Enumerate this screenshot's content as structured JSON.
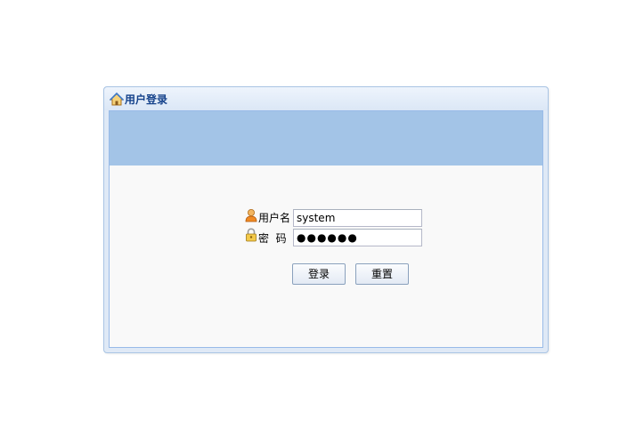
{
  "panel": {
    "title": "用户登录",
    "title_icon": "home-icon"
  },
  "form": {
    "username_label": "用户名",
    "username_icon": "user-icon",
    "username_value": "system",
    "password_label": "密  码",
    "password_icon": "lock-icon",
    "password_value": "●●●●●●"
  },
  "buttons": {
    "login_label": "登录",
    "reset_label": "重置"
  },
  "colors": {
    "banner": "#a3c4e7",
    "title_text": "#15428b",
    "panel_border": "#99bbe8"
  }
}
